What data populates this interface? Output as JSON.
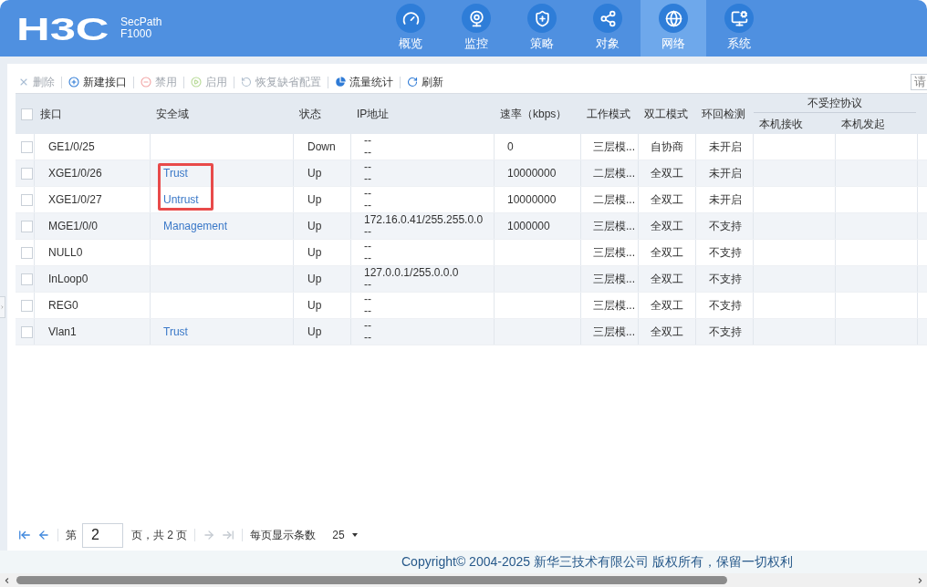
{
  "header": {
    "logo": "H3C",
    "product_line": "SecPath",
    "model": "F1000"
  },
  "nav": [
    {
      "label": "概览",
      "selected": false
    },
    {
      "label": "监控",
      "selected": false
    },
    {
      "label": "策略",
      "selected": false
    },
    {
      "label": "对象",
      "selected": false
    },
    {
      "label": "网络",
      "selected": true
    },
    {
      "label": "系统",
      "selected": false
    }
  ],
  "toolbar": [
    {
      "label": "删除",
      "disabled": true
    },
    {
      "label": "新建接口",
      "disabled": false
    },
    {
      "label": "禁用",
      "disabled": true
    },
    {
      "label": "启用",
      "disabled": true
    },
    {
      "label": "恢复缺省配置",
      "disabled": true
    },
    {
      "label": "流量统计",
      "disabled": false
    },
    {
      "label": "刷新",
      "disabled": false
    }
  ],
  "search": {
    "placeholder": "请"
  },
  "table": {
    "select_all_checked": false,
    "columns": [
      "接口",
      "安全域",
      "状态",
      "IP地址",
      "速率（kbps）",
      "工作模式",
      "双工模式",
      "环回检测"
    ],
    "column_group": {
      "label": "不受控协议",
      "columns": [
        "本机接收",
        "本机发起"
      ]
    },
    "rows": [
      {
        "checked": false,
        "highlighted": false,
        "interface": "GE1/0/25",
        "status": "Down",
        "ip_lines": [
          "--",
          "--"
        ],
        "rate": "0",
        "mode": "三层模...",
        "duplex": "自协商",
        "loopback": "未开启"
      },
      {
        "checked": false,
        "highlighted": true,
        "interface": "XGE1/0/26",
        "zone": "Trust",
        "status": "Up",
        "ip_lines": [
          "--",
          "--"
        ],
        "rate": "10000000",
        "mode": "二层模...",
        "duplex": "全双工",
        "loopback": "未开启"
      },
      {
        "checked": false,
        "highlighted": true,
        "interface": "XGE1/0/27",
        "zone": "Untrust",
        "status": "Up",
        "ip_lines": [
          "--",
          "--"
        ],
        "rate": "10000000",
        "mode": "二层模...",
        "duplex": "全双工",
        "loopback": "未开启"
      },
      {
        "checked": false,
        "highlighted": false,
        "interface": "MGE1/0/0",
        "zone": "Management",
        "status": "Up",
        "ip_lines": [
          "172.16.0.41/255.255.0.0",
          "--"
        ],
        "rate": "1000000",
        "mode": "三层模...",
        "duplex": "全双工",
        "loopback": "不支持"
      },
      {
        "checked": false,
        "highlighted": false,
        "interface": "NULL0",
        "status": "Up",
        "ip_lines": [
          "--",
          "--"
        ],
        "mode": "三层模...",
        "duplex": "全双工",
        "loopback": "不支持"
      },
      {
        "checked": false,
        "highlighted": false,
        "interface": "InLoop0",
        "status": "Up",
        "ip_lines": [
          "127.0.0.1/255.0.0.0",
          "--"
        ],
        "mode": "三层模...",
        "duplex": "全双工",
        "loopback": "不支持"
      },
      {
        "checked": false,
        "highlighted": false,
        "interface": "REG0",
        "status": "Up",
        "ip_lines": [
          "--",
          "--"
        ],
        "mode": "三层模...",
        "duplex": "全双工",
        "loopback": "不支持"
      },
      {
        "checked": false,
        "highlighted": false,
        "interface": "Vlan1",
        "zone": "Trust",
        "status": "Up",
        "ip_lines": [
          "--",
          "--"
        ],
        "mode": "三层模...",
        "duplex": "全双工",
        "loopback": "不支持"
      }
    ]
  },
  "pager": {
    "first_disabled": false,
    "prev_disabled": false,
    "page_prefix": "第",
    "page": "2",
    "page_suffix": "页，共 2 页",
    "next_disabled": true,
    "last_disabled": true,
    "page_size_label": "每页显示条数",
    "page_size": "25"
  },
  "copyright": "Copyright© 2004-2025 新华三技术有限公司 版权所有，保留一切权利"
}
